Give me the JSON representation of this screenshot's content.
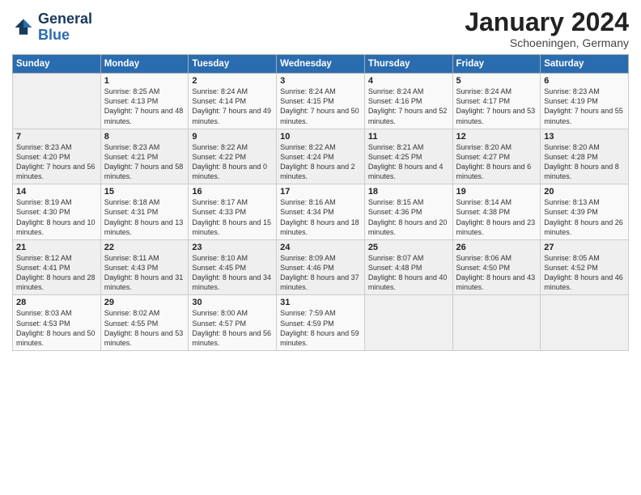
{
  "header": {
    "logo_general": "General",
    "logo_blue": "Blue",
    "month_title": "January 2024",
    "subtitle": "Schoeningen, Germany"
  },
  "weekdays": [
    "Sunday",
    "Monday",
    "Tuesday",
    "Wednesday",
    "Thursday",
    "Friday",
    "Saturday"
  ],
  "weeks": [
    [
      {
        "day": "",
        "sunrise": "",
        "sunset": "",
        "daylight": ""
      },
      {
        "day": "1",
        "sunrise": "Sunrise: 8:25 AM",
        "sunset": "Sunset: 4:13 PM",
        "daylight": "Daylight: 7 hours and 48 minutes."
      },
      {
        "day": "2",
        "sunrise": "Sunrise: 8:24 AM",
        "sunset": "Sunset: 4:14 PM",
        "daylight": "Daylight: 7 hours and 49 minutes."
      },
      {
        "day": "3",
        "sunrise": "Sunrise: 8:24 AM",
        "sunset": "Sunset: 4:15 PM",
        "daylight": "Daylight: 7 hours and 50 minutes."
      },
      {
        "day": "4",
        "sunrise": "Sunrise: 8:24 AM",
        "sunset": "Sunset: 4:16 PM",
        "daylight": "Daylight: 7 hours and 52 minutes."
      },
      {
        "day": "5",
        "sunrise": "Sunrise: 8:24 AM",
        "sunset": "Sunset: 4:17 PM",
        "daylight": "Daylight: 7 hours and 53 minutes."
      },
      {
        "day": "6",
        "sunrise": "Sunrise: 8:23 AM",
        "sunset": "Sunset: 4:19 PM",
        "daylight": "Daylight: 7 hours and 55 minutes."
      }
    ],
    [
      {
        "day": "7",
        "sunrise": "Sunrise: 8:23 AM",
        "sunset": "Sunset: 4:20 PM",
        "daylight": "Daylight: 7 hours and 56 minutes."
      },
      {
        "day": "8",
        "sunrise": "Sunrise: 8:23 AM",
        "sunset": "Sunset: 4:21 PM",
        "daylight": "Daylight: 7 hours and 58 minutes."
      },
      {
        "day": "9",
        "sunrise": "Sunrise: 8:22 AM",
        "sunset": "Sunset: 4:22 PM",
        "daylight": "Daylight: 8 hours and 0 minutes."
      },
      {
        "day": "10",
        "sunrise": "Sunrise: 8:22 AM",
        "sunset": "Sunset: 4:24 PM",
        "daylight": "Daylight: 8 hours and 2 minutes."
      },
      {
        "day": "11",
        "sunrise": "Sunrise: 8:21 AM",
        "sunset": "Sunset: 4:25 PM",
        "daylight": "Daylight: 8 hours and 4 minutes."
      },
      {
        "day": "12",
        "sunrise": "Sunrise: 8:20 AM",
        "sunset": "Sunset: 4:27 PM",
        "daylight": "Daylight: 8 hours and 6 minutes."
      },
      {
        "day": "13",
        "sunrise": "Sunrise: 8:20 AM",
        "sunset": "Sunset: 4:28 PM",
        "daylight": "Daylight: 8 hours and 8 minutes."
      }
    ],
    [
      {
        "day": "14",
        "sunrise": "Sunrise: 8:19 AM",
        "sunset": "Sunset: 4:30 PM",
        "daylight": "Daylight: 8 hours and 10 minutes."
      },
      {
        "day": "15",
        "sunrise": "Sunrise: 8:18 AM",
        "sunset": "Sunset: 4:31 PM",
        "daylight": "Daylight: 8 hours and 13 minutes."
      },
      {
        "day": "16",
        "sunrise": "Sunrise: 8:17 AM",
        "sunset": "Sunset: 4:33 PM",
        "daylight": "Daylight: 8 hours and 15 minutes."
      },
      {
        "day": "17",
        "sunrise": "Sunrise: 8:16 AM",
        "sunset": "Sunset: 4:34 PM",
        "daylight": "Daylight: 8 hours and 18 minutes."
      },
      {
        "day": "18",
        "sunrise": "Sunrise: 8:15 AM",
        "sunset": "Sunset: 4:36 PM",
        "daylight": "Daylight: 8 hours and 20 minutes."
      },
      {
        "day": "19",
        "sunrise": "Sunrise: 8:14 AM",
        "sunset": "Sunset: 4:38 PM",
        "daylight": "Daylight: 8 hours and 23 minutes."
      },
      {
        "day": "20",
        "sunrise": "Sunrise: 8:13 AM",
        "sunset": "Sunset: 4:39 PM",
        "daylight": "Daylight: 8 hours and 26 minutes."
      }
    ],
    [
      {
        "day": "21",
        "sunrise": "Sunrise: 8:12 AM",
        "sunset": "Sunset: 4:41 PM",
        "daylight": "Daylight: 8 hours and 28 minutes."
      },
      {
        "day": "22",
        "sunrise": "Sunrise: 8:11 AM",
        "sunset": "Sunset: 4:43 PM",
        "daylight": "Daylight: 8 hours and 31 minutes."
      },
      {
        "day": "23",
        "sunrise": "Sunrise: 8:10 AM",
        "sunset": "Sunset: 4:45 PM",
        "daylight": "Daylight: 8 hours and 34 minutes."
      },
      {
        "day": "24",
        "sunrise": "Sunrise: 8:09 AM",
        "sunset": "Sunset: 4:46 PM",
        "daylight": "Daylight: 8 hours and 37 minutes."
      },
      {
        "day": "25",
        "sunrise": "Sunrise: 8:07 AM",
        "sunset": "Sunset: 4:48 PM",
        "daylight": "Daylight: 8 hours and 40 minutes."
      },
      {
        "day": "26",
        "sunrise": "Sunrise: 8:06 AM",
        "sunset": "Sunset: 4:50 PM",
        "daylight": "Daylight: 8 hours and 43 minutes."
      },
      {
        "day": "27",
        "sunrise": "Sunrise: 8:05 AM",
        "sunset": "Sunset: 4:52 PM",
        "daylight": "Daylight: 8 hours and 46 minutes."
      }
    ],
    [
      {
        "day": "28",
        "sunrise": "Sunrise: 8:03 AM",
        "sunset": "Sunset: 4:53 PM",
        "daylight": "Daylight: 8 hours and 50 minutes."
      },
      {
        "day": "29",
        "sunrise": "Sunrise: 8:02 AM",
        "sunset": "Sunset: 4:55 PM",
        "daylight": "Daylight: 8 hours and 53 minutes."
      },
      {
        "day": "30",
        "sunrise": "Sunrise: 8:00 AM",
        "sunset": "Sunset: 4:57 PM",
        "daylight": "Daylight: 8 hours and 56 minutes."
      },
      {
        "day": "31",
        "sunrise": "Sunrise: 7:59 AM",
        "sunset": "Sunset: 4:59 PM",
        "daylight": "Daylight: 8 hours and 59 minutes."
      },
      {
        "day": "",
        "sunrise": "",
        "sunset": "",
        "daylight": ""
      },
      {
        "day": "",
        "sunrise": "",
        "sunset": "",
        "daylight": ""
      },
      {
        "day": "",
        "sunrise": "",
        "sunset": "",
        "daylight": ""
      }
    ]
  ]
}
